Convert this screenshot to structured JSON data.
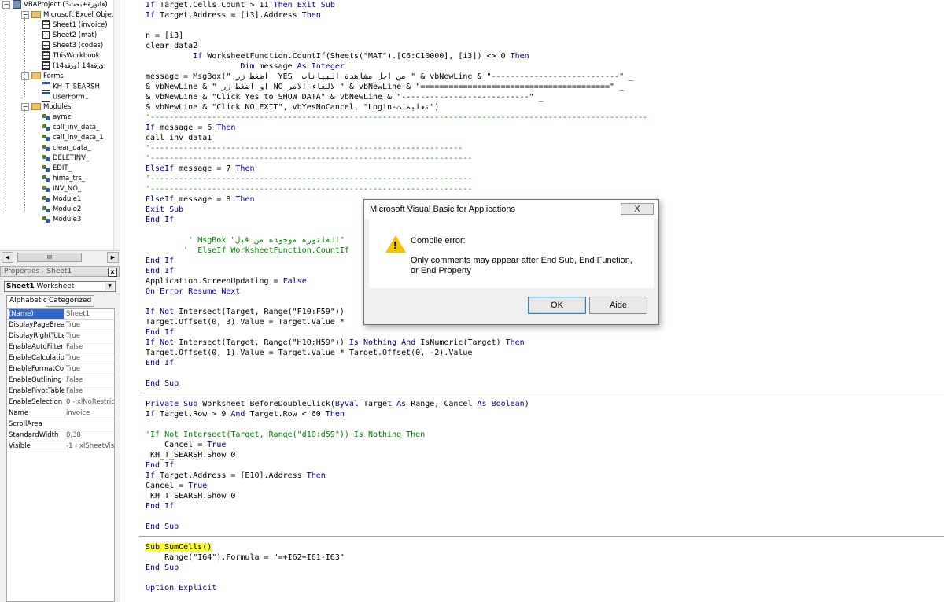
{
  "project_explorer": {
    "root": "VBAProject (فاتورة+بحث3)",
    "folder_excel_objects": "Microsoft Excel Objects",
    "excel_objects": [
      "Sheet1 (invoice)",
      "Sheet2 (mat)",
      "Sheet3 (codes)",
      "ThisWorkbook",
      "ورقة14 (ورقة14)"
    ],
    "folder_forms": "Forms",
    "forms": [
      "KH_T_SEARSH",
      "UserForm1"
    ],
    "folder_modules": "Modules",
    "modules": [
      "aymz",
      "call_inv_data_",
      "call_inv_data_1",
      "clear_data_",
      "DELETINV_",
      "EDIT_",
      "hima_trs_",
      "INV_NO_",
      "Module1",
      "Module2",
      "Module3"
    ],
    "expander_minus": "−",
    "scroll_thumb_label": "III"
  },
  "properties": {
    "title": "Properties - Sheet1",
    "close_label": "x",
    "combo_object": "Sheet1",
    "combo_type": "Worksheet",
    "tab_alphabetic": "Alphabetic",
    "tab_categorized": "Categorized",
    "rows": [
      {
        "name": "(Name)",
        "value": "Sheet1"
      },
      {
        "name": "DisplayPageBreak",
        "value": "True"
      },
      {
        "name": "DisplayRightToLef",
        "value": "True"
      },
      {
        "name": "EnableAutoFilter",
        "value": "False"
      },
      {
        "name": "EnableCalculation",
        "value": "True"
      },
      {
        "name": "EnableFormatCon",
        "value": "True"
      },
      {
        "name": "EnableOutlining",
        "value": "False"
      },
      {
        "name": "EnablePivotTable",
        "value": "False"
      },
      {
        "name": "EnableSelection",
        "value": "0 - xlNoRestrictio"
      },
      {
        "name": "Name",
        "value": "invoice"
      },
      {
        "name": "ScrollArea",
        "value": ""
      },
      {
        "name": "StandardWidth",
        "value": "8,38"
      },
      {
        "name": "Visible",
        "value": "-1 - xlSheetVisib"
      }
    ]
  },
  "code": {
    "lines": [
      "If Target.Cells.Count > 11 Then Exit Sub",
      "If Target.Address = [i3].Address Then",
      "",
      "n = [i3]",
      "clear_data2",
      "          If WorksheetFunction.CountIf(Sheets(\"MAT\").[C6:C10000], [i3]) <> 0 Then",
      "                    Dim message As Integer",
      "message = MsgBox(\" اضغط زر  YES  من اجل مشاهدة البيانات \" & vbNewLine & \"---------------------------\" _",
      "& vbNewLine & \" او اضغط زر NO لالغاء الامر \" & vbNewLine & \"========================================\" _",
      "& vbNewLine & \"Click Yes to SHOW DATA\" & vbNewLine & \"---------------------------\" _",
      "& vbNewLine & \"Click NO EXIT\", vbYesNoCancel, \"Login-تعليمات\")",
      "'---------------------------------------------------------------------------------------------------------",
      "If message = 6 Then",
      "call_inv_data1",
      "'------------------------------------------------------------------",
      "'--------------------------------------------------------------------",
      "ElseIf message = 7 Then",
      "'--------------------------------------------------------------------",
      "'--------------------------------------------------------------------",
      "ElseIf message = 8 Then",
      "Exit Sub",
      "End If",
      "",
      "         ' MsgBox \"الفاتوره موجوده من قبل\"",
      "        '  ElseIf WorksheetFunction.CountIf",
      "End If",
      "End If",
      "Application.ScreenUpdating = False",
      "On Error Resume Next",
      "",
      "If Not Intersect(Target, Range(\"F10:F59\"))",
      "Target.Offset(0, 3).Value = Target.Value *",
      "End If",
      "If Not Intersect(Target, Range(\"H10:H59\")) Is Nothing And IsNumeric(Target) Then",
      "Target.Offset(0, 1).Value = Target.Value * Target.Offset(0, -2).Value",
      "End If",
      "",
      "End Sub",
      "",
      "Private Sub Worksheet_BeforeDoubleClick(ByVal Target As Range, Cancel As Boolean)",
      "If Target.Row > 9 And Target.Row < 60 Then",
      "",
      "'If Not Intersect(Target, Range(\"d10:d59\")) Is Nothing Then",
      "    Cancel = True",
      " KH_T_SEARSH.Show 0",
      "End If",
      "If Target.Address = [E10].Address Then",
      "Cancel = True",
      " KH_T_SEARSH.Show 0",
      "End If",
      "",
      "End Sub",
      "",
      "Sub SumCells()",
      "    Range(\"I64\").Formula = \"=+I62+I61-I63\"",
      "End Sub",
      "",
      "Option Explicit"
    ]
  },
  "dialog": {
    "title": "Microsoft Visual Basic for Applications",
    "close_label": "X",
    "icon": "warning-icon",
    "icon_glyph": "!",
    "heading": "Compile error:",
    "message": "Only comments may appear after End Sub, End Function, or End Property",
    "ok_label": "OK",
    "aide_label": "Aide"
  },
  "colors": {
    "keyword": "#00008b",
    "comment": "#008000",
    "highlight": "#ffff33",
    "selected_property": "#3366cc"
  }
}
